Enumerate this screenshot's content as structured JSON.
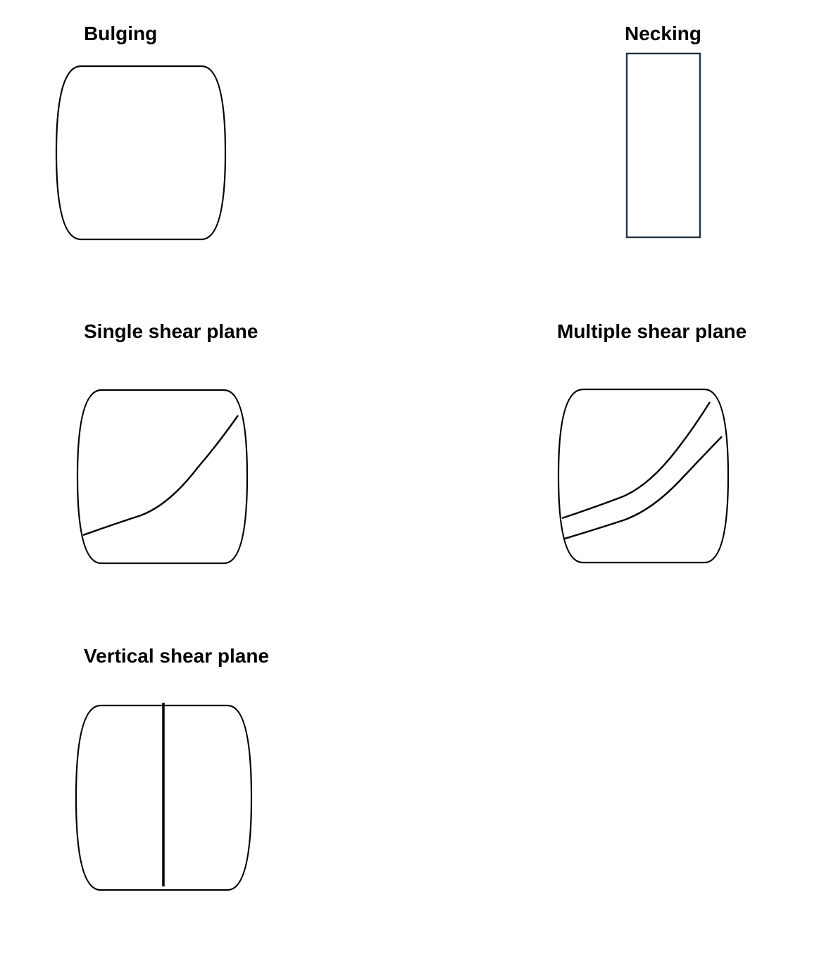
{
  "diagram": {
    "panels": [
      {
        "id": "bulging",
        "label": "Bulging"
      },
      {
        "id": "necking",
        "label": "Necking"
      },
      {
        "id": "single",
        "label": "Single shear plane"
      },
      {
        "id": "multiple",
        "label": "Multiple shear plane"
      },
      {
        "id": "vertical",
        "label": "Vertical shear plane"
      }
    ]
  },
  "colors": {
    "stroke": "#000000",
    "necking_stroke": "#1f3347",
    "background": "#ffffff"
  }
}
